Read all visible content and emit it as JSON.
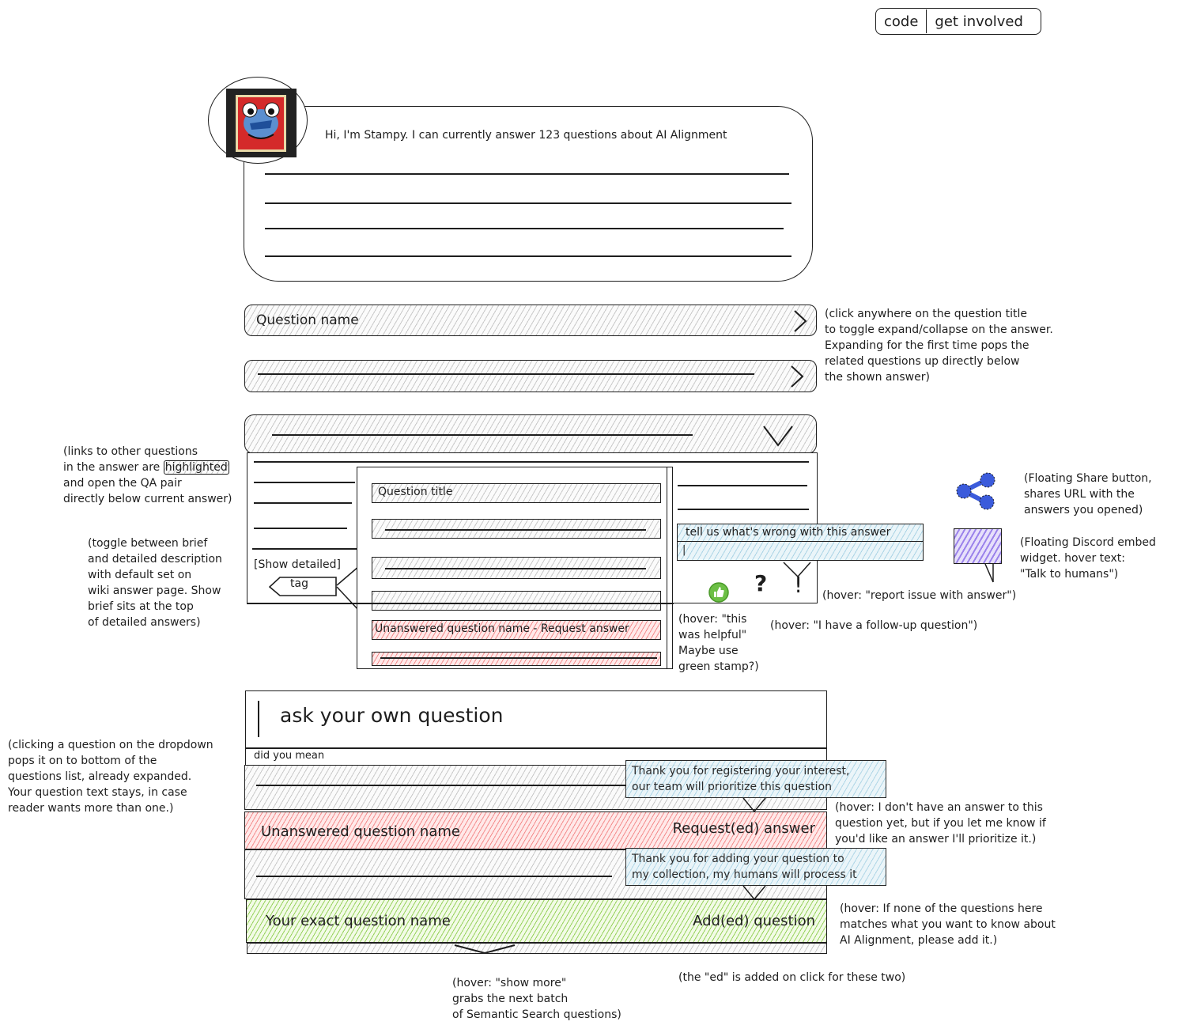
{
  "nav": {
    "items": [
      "code",
      "get involved"
    ]
  },
  "intro": {
    "avatar_alt": "Stampy stamp mascot",
    "greeting": "Hi, I'm Stampy. I can currently answer 123 questions about AI Alignment"
  },
  "questions": {
    "collapsed_1": "Question name",
    "expand_note": "(click anywhere on the question title\nto toggle expand/collapse on the answer.\nExpanding for the first time pops the\nrelated questions up directly below\nthe shown answer)"
  },
  "answer": {
    "show_toggle": "[Show detailed]",
    "tag": "tag",
    "links_note_before": "(links to other questions\nin the answer are ",
    "links_note_highlight": "highlighted",
    "links_note_after": "\nand open the QA pair\ndirectly below current answer)",
    "toggle_note": "(toggle between brief\nand detailed description\nwith default set on\nwiki answer page. Show\nbrief sits at the top\nof detailed answers)",
    "related": {
      "title": "Question title",
      "unanswered": "Unanswered question name - Request answer"
    },
    "feedback": {
      "title": "tell us what's wrong with this answer",
      "input_value": "|"
    },
    "actions": {
      "helpful_icon": "thumbs-up-icon",
      "followup_glyph": "?",
      "report_glyph": "!"
    },
    "notes": {
      "report": "(hover: \"report issue with answer\")",
      "helpful": "(hover: \"this\nwas helpful\"\nMaybe use\ngreen stamp?)",
      "followup": "(hover: \"I have a follow-up question\")"
    }
  },
  "floating": {
    "share_icon": "share-icon",
    "share_note": "(Floating Share button,\nshares URL with the\nanswers you opened)",
    "discord_icon": "discord-widget-icon",
    "discord_note": "(Floating Discord embed\nwidget. hover text:\n\"Talk to humans\")"
  },
  "search": {
    "placeholder": "ask your own question",
    "did_you_mean": "did you mean",
    "dropdown_note": "(clicking a question on the dropdown\npops it on to bottom of the\nquestions list, already expanded.\nYour question text stays, in case\nreader wants more than one.)",
    "unanswered": {
      "name": "Unanswered question name",
      "action": "Request(ed) answer",
      "tooltip": "Thank you for registering your interest,\nour team will prioritize this question",
      "note": "(hover: I don't have an answer to this\nquestion yet, but if you let me know if\nyou'd like an answer I'll prioritize it.)"
    },
    "exact": {
      "name": "Your exact question name",
      "action": "Add(ed) question",
      "tooltip": "Thank you for adding your question to\nmy collection, my humans will process it",
      "note": "(hover: If none of the questions here\nmatches what you want to know about\nAI Alignment, please add it.)"
    },
    "ed_note": "(the \"ed\" is added on click for these two)",
    "show_more_note": "(hover: \"show more\"\ngrabs the next batch\nof Semantic Search questions)"
  },
  "colors": {
    "stroke": "#1e1e1e",
    "unanswered_fill": "#ffc9c9",
    "exact_fill": "#b2f2bb",
    "tooltip_fill": "#d0ebff",
    "share_blue": "#3b5bdb",
    "discord_purple": "#9775fa",
    "helpful_green": "#6cbf45"
  }
}
